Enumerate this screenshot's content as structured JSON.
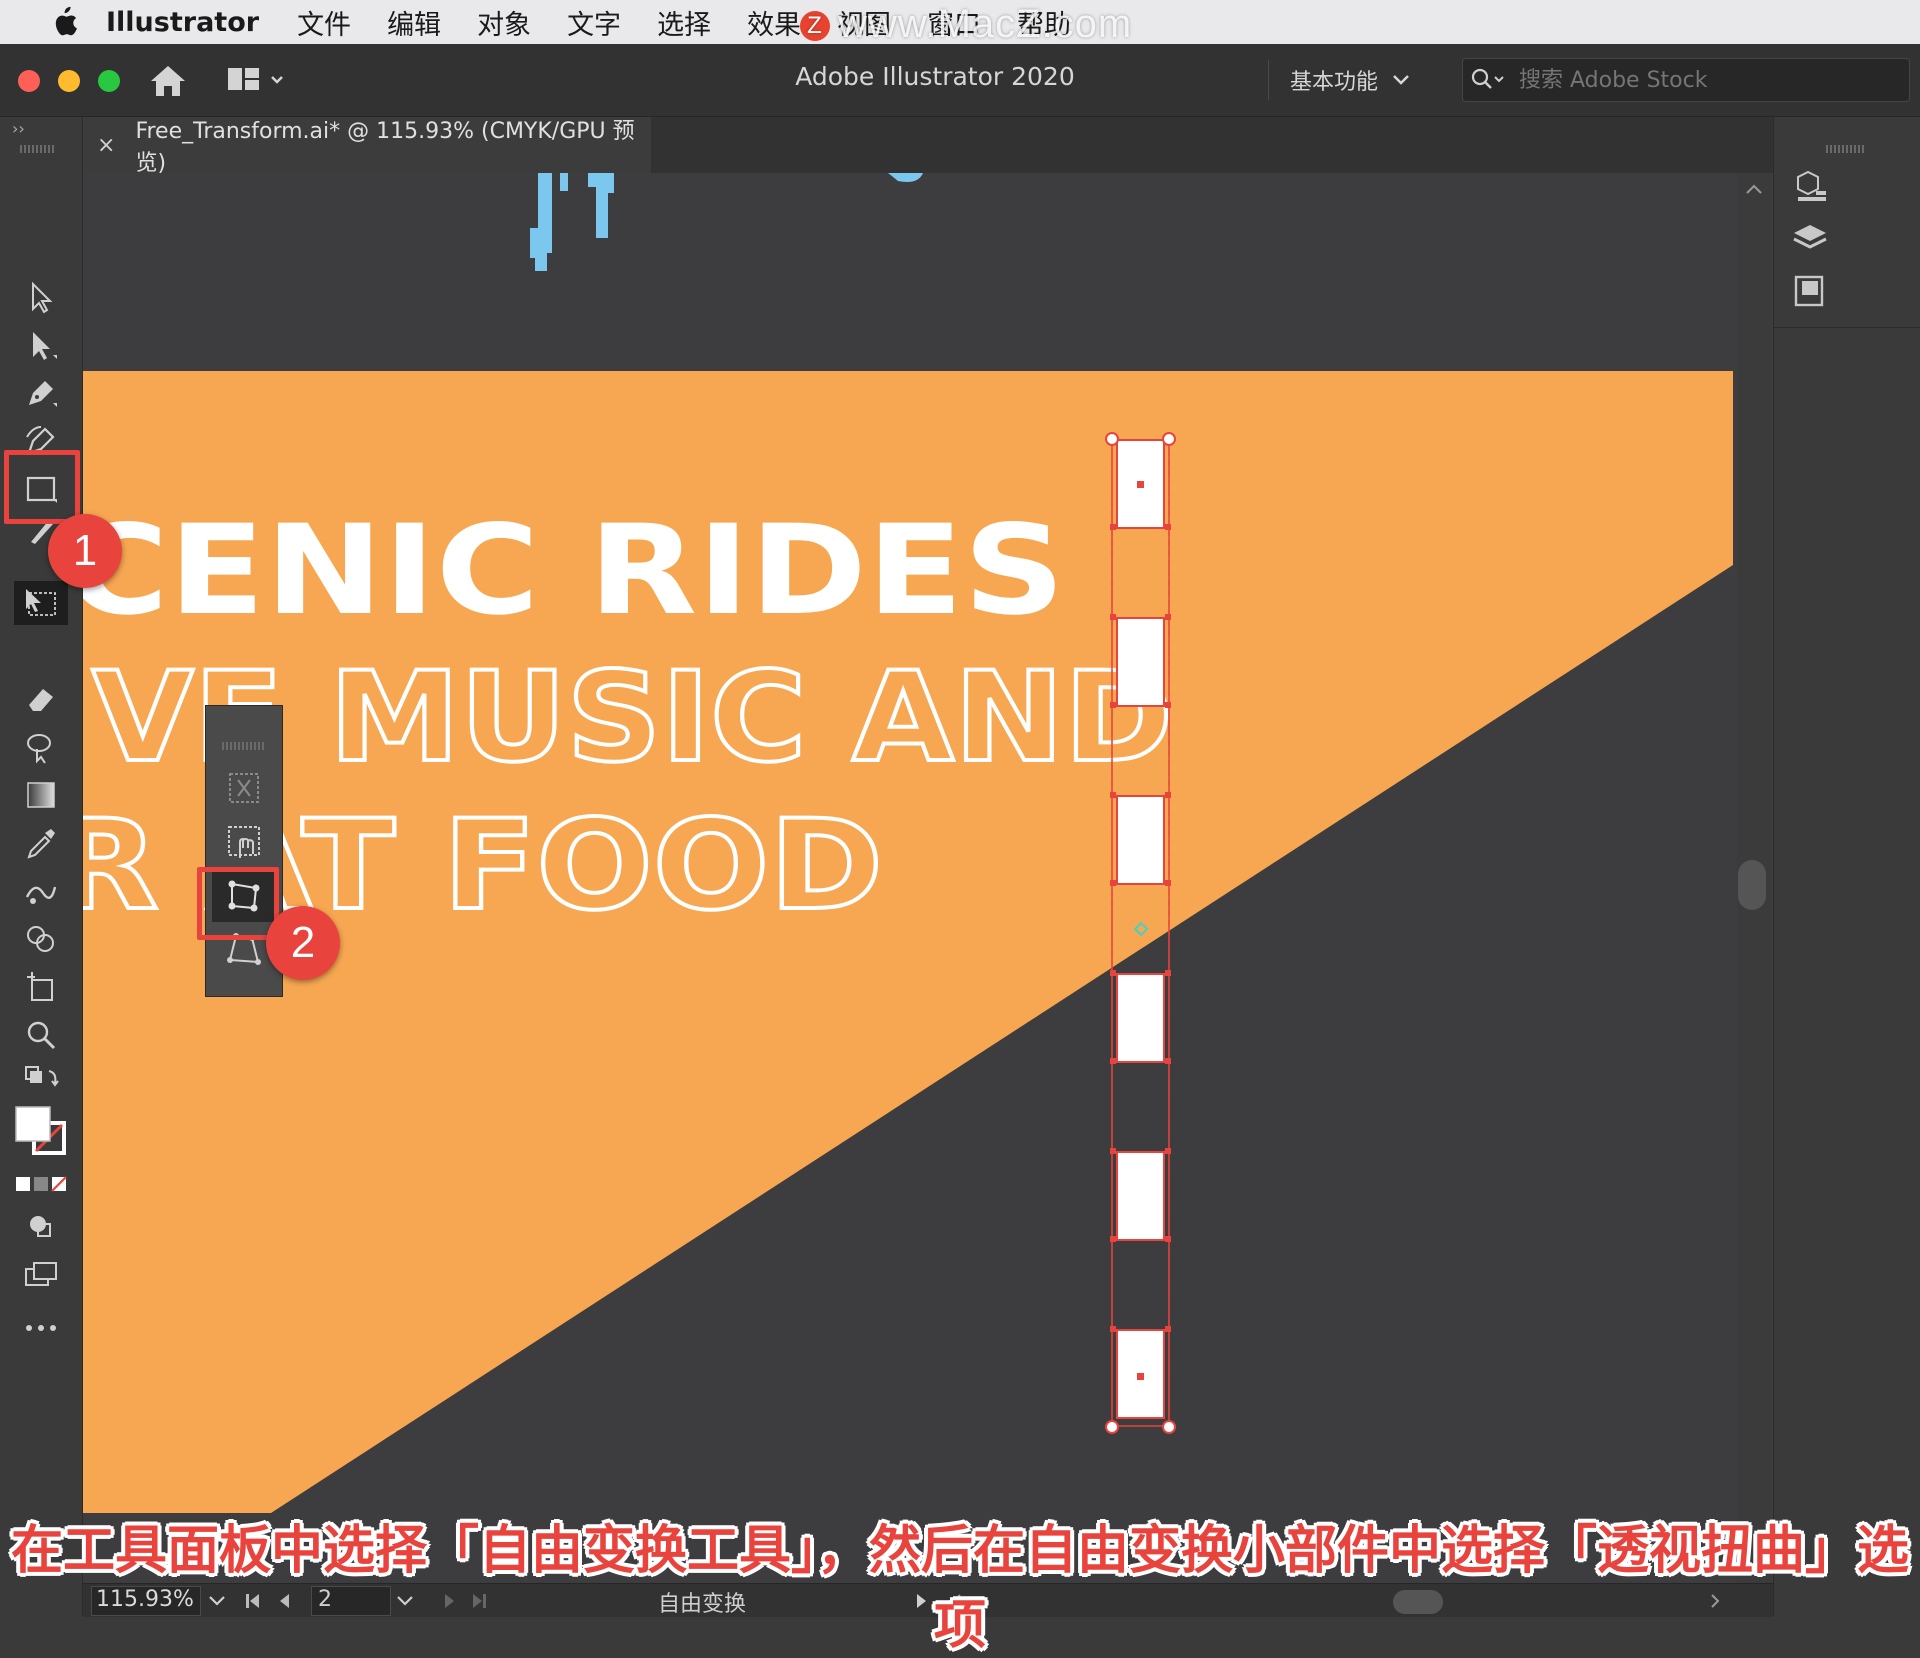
{
  "menubar": {
    "app_name": "Illustrator",
    "items": [
      "文件",
      "编辑",
      "对象",
      "文字",
      "选择",
      "效果",
      "视图",
      "窗口",
      "帮助"
    ],
    "watermark": "www.MacZ.com",
    "watermark_badge": "Z"
  },
  "appbar": {
    "title": "Adobe Illustrator 2020",
    "workspace": "基本功能",
    "search_placeholder": "搜索 Adobe Stock"
  },
  "document_tab": {
    "close": "×",
    "label": "Free_Transform.ai* @ 115.93% (CMYK/GPU 预览)"
  },
  "artwork": {
    "line1": "CENIC RIDES",
    "line2": "IVE MUSIC AND",
    "line3": "R AT FOOD",
    "colors": {
      "orange": "#f7a751",
      "dark": "#3d3d3f",
      "blue": "#7cc7ee",
      "selection": "#e8433d"
    }
  },
  "badges": {
    "one": "1",
    "two": "2"
  },
  "statusbar": {
    "zoom": "115.93%",
    "page": "2",
    "tool_name": "自由变换"
  },
  "caption": "在工具面板中选择「自由变换工具」，然后在自由变换小部件中选择「透视扭曲」选项",
  "collapse_left": "››",
  "collapse_right": "‹‹"
}
